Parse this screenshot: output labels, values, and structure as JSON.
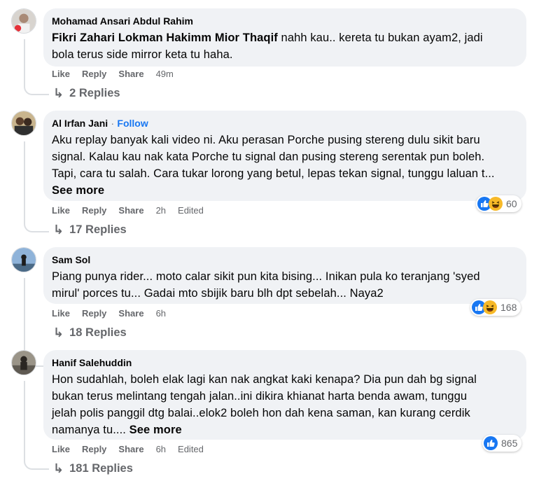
{
  "comments": [
    {
      "author": "Mohamad Ansari Abdul Rahim",
      "mention": "Fikri Zahari Lokman Hakimm Mior Thaqif",
      "line1_rest": " nahh kau.. kereta tu bukan ayam2, jadi",
      "line2": "bola terus side mirror keta tu haha.",
      "actions": {
        "like": "Like",
        "reply": "Reply",
        "share": "Share",
        "time": "49m"
      },
      "replies": "2 Replies"
    },
    {
      "author": "Al Irfan Jani",
      "separator": "·",
      "follow": "Follow",
      "line1": "Aku replay banyak kali video ni. Aku perasan Porche pusing stereng dulu sikit baru",
      "line2": "signal. Kalau kau nak kata Porche tu signal dan pusing stereng serentak pun boleh.",
      "line3": "Tapi, cara tu salah. Cara tukar lorong yang betul, lepas tekan signal, tunggu laluan t...",
      "see_more": "See more",
      "actions": {
        "like": "Like",
        "reply": "Reply",
        "share": "Share",
        "time": "2h",
        "edited": "Edited"
      },
      "reaction_icons": [
        "like-icon",
        "haha-icon"
      ],
      "reaction_count": "60",
      "replies": "17 Replies"
    },
    {
      "author": "Sam Sol",
      "line1": "Piang punya rider... moto calar sikit pun kita bising... Inikan pula ko teranjang 'syed",
      "line2": "mirul' porces tu... Gadai mto sbijik baru blh dpt sebelah... Naya2",
      "actions": {
        "like": "Like",
        "reply": "Reply",
        "share": "Share",
        "time": "6h"
      },
      "reaction_icons": [
        "like-icon",
        "haha-icon"
      ],
      "reaction_count": "168",
      "replies": "18 Replies"
    },
    {
      "author": "Hanif Salehuddin",
      "line1": "Hon sudahlah, boleh elak lagi kan nak angkat kaki kenapa? Dia pun dah bg signal",
      "line2": "bukan terus melintang tengah jalan..ini dikira khianat harta benda awam, tunggu",
      "line3": "jelah polis panggil dtg balai..elok2 boleh hon dah kena saman, kan kurang cerdik",
      "line4_text": "namanya tu.... ",
      "see_more": "See more",
      "actions": {
        "like": "Like",
        "reply": "Reply",
        "share": "Share",
        "time": "6h",
        "edited": "Edited"
      },
      "reaction_icons": [
        "like-icon"
      ],
      "reaction_count": "865",
      "replies": "181 Replies"
    }
  ],
  "colors": {
    "bubble": "#f0f2f5",
    "meta_text": "#65676b",
    "follow": "#1877f2",
    "like_blue": "#1877f2",
    "haha_yellow": "#f7b928"
  }
}
